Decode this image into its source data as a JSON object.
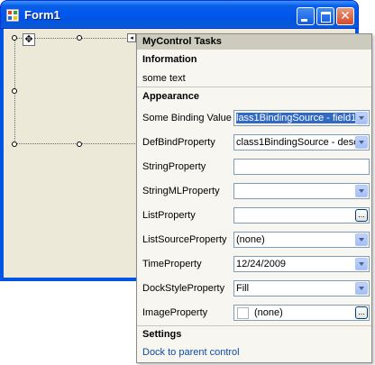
{
  "form": {
    "title": "Form1"
  },
  "panel": {
    "title": "MyControl Tasks",
    "information": {
      "heading": "Information",
      "text": "some text"
    },
    "appearance": {
      "heading": "Appearance",
      "properties": [
        {
          "label": "Some Binding Value",
          "value": "lass1BindingSource - field1",
          "control": "dropdown",
          "selected": true
        },
        {
          "label": "DefBindProperty",
          "value": "class1BindingSource - desc",
          "control": "dropdown"
        },
        {
          "label": "StringProperty",
          "value": "",
          "control": "textbox"
        },
        {
          "label": "StringMLProperty",
          "value": "",
          "control": "dropdown"
        },
        {
          "label": "ListProperty",
          "value": "",
          "control": "ellipsis",
          "button": "..."
        },
        {
          "label": "ListSourceProperty",
          "value": "(none)",
          "control": "dropdown"
        },
        {
          "label": "TimeProperty",
          "value": "12/24/2009",
          "control": "dropdown"
        },
        {
          "label": "DockStyleProperty",
          "value": "Fill",
          "control": "dropdown"
        },
        {
          "label": "ImageProperty",
          "value": "(none)",
          "control": "image-ellipsis",
          "button": "..."
        }
      ]
    },
    "settings": {
      "heading": "Settings",
      "link": "Dock to parent control"
    }
  },
  "colors": {
    "titlebar": "#0054e3",
    "client": "#ece9d8",
    "panel": "#f7f6f1",
    "header": "#cdcbbd",
    "link": "#0e4ca1",
    "selection": "#316ac5"
  }
}
